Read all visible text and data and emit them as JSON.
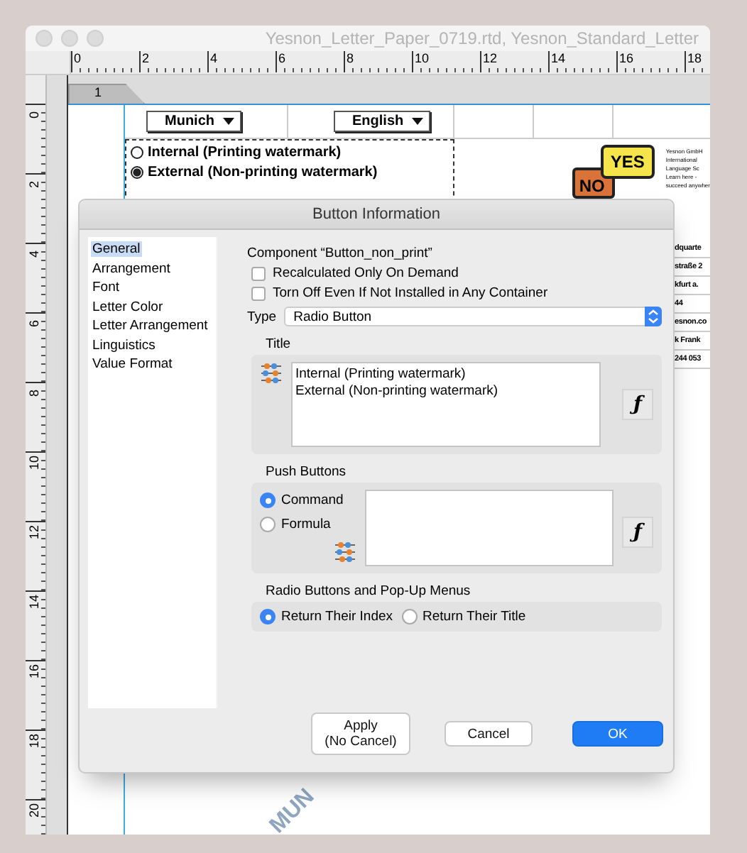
{
  "window": {
    "title": "Yesnon_Letter_Paper_0719.rtd, Yesnon_Standard_Letter"
  },
  "ruler": {
    "horizontal": [
      "0",
      "2",
      "4",
      "6",
      "8",
      "10",
      "12",
      "14",
      "16",
      "18"
    ],
    "vertical": [
      "0",
      "2",
      "4",
      "6",
      "8",
      "10",
      "12",
      "14",
      "16",
      "18",
      "20"
    ]
  },
  "page_tabs": [
    {
      "label": "1",
      "selected": true
    }
  ],
  "document": {
    "dropdowns": [
      {
        "value": "Munich"
      },
      {
        "value": "English"
      }
    ],
    "radios": [
      {
        "label": "Internal (Printing watermark)",
        "selected": false
      },
      {
        "label": "External (Non-printing watermark)",
        "selected": true
      }
    ],
    "logo": {
      "bubbles": [
        "NO",
        "YES"
      ],
      "lines": [
        "Yesnon GmbH",
        "International",
        "Language Sc",
        "Learn here -",
        "succeed anywher"
      ]
    },
    "address_lines": [
      "dquarte",
      "straße 2",
      "kfurt a.",
      "44",
      "esnon.co",
      "k Frank",
      "244 053"
    ],
    "watermark": "MUN"
  },
  "dialog": {
    "title": "Button Information",
    "categories": [
      {
        "label": "General",
        "selected": true
      },
      {
        "label": "Arrangement",
        "selected": false
      },
      {
        "label": "Font",
        "selected": false
      },
      {
        "label": "Letter Color",
        "selected": false
      },
      {
        "label": "Letter Arrangement",
        "selected": false
      },
      {
        "label": "Linguistics",
        "selected": false
      },
      {
        "label": "Value Format",
        "selected": false
      }
    ],
    "component": "Component “Button_non_print”",
    "options": [
      {
        "label": "Recalculated Only On Demand",
        "checked": false
      },
      {
        "label": "Torn Off Even If Not Installed in Any Container",
        "checked": false
      }
    ],
    "type": {
      "label": "Type",
      "value": "Radio Button"
    },
    "title_group": {
      "label": "Title",
      "text": "Internal (Printing watermark)\nExternal (Non-printing watermark)",
      "formula_button": "ƒ"
    },
    "push_buttons": {
      "label": "Push Buttons",
      "radios": [
        {
          "label": "Command",
          "selected": true
        },
        {
          "label": "Formula",
          "selected": false
        }
      ],
      "formula_button": "ƒ"
    },
    "return_group": {
      "label": "Radio Buttons and Pop-Up Menus",
      "radios": [
        {
          "label": "Return Their Index",
          "selected": true
        },
        {
          "label": "Return Their Title",
          "selected": false
        }
      ]
    },
    "buttons": [
      {
        "label": "Apply\n(No Cancel)",
        "kind": "normal"
      },
      {
        "label": "Cancel",
        "kind": "normal"
      },
      {
        "label": "OK",
        "kind": "default"
      }
    ]
  }
}
